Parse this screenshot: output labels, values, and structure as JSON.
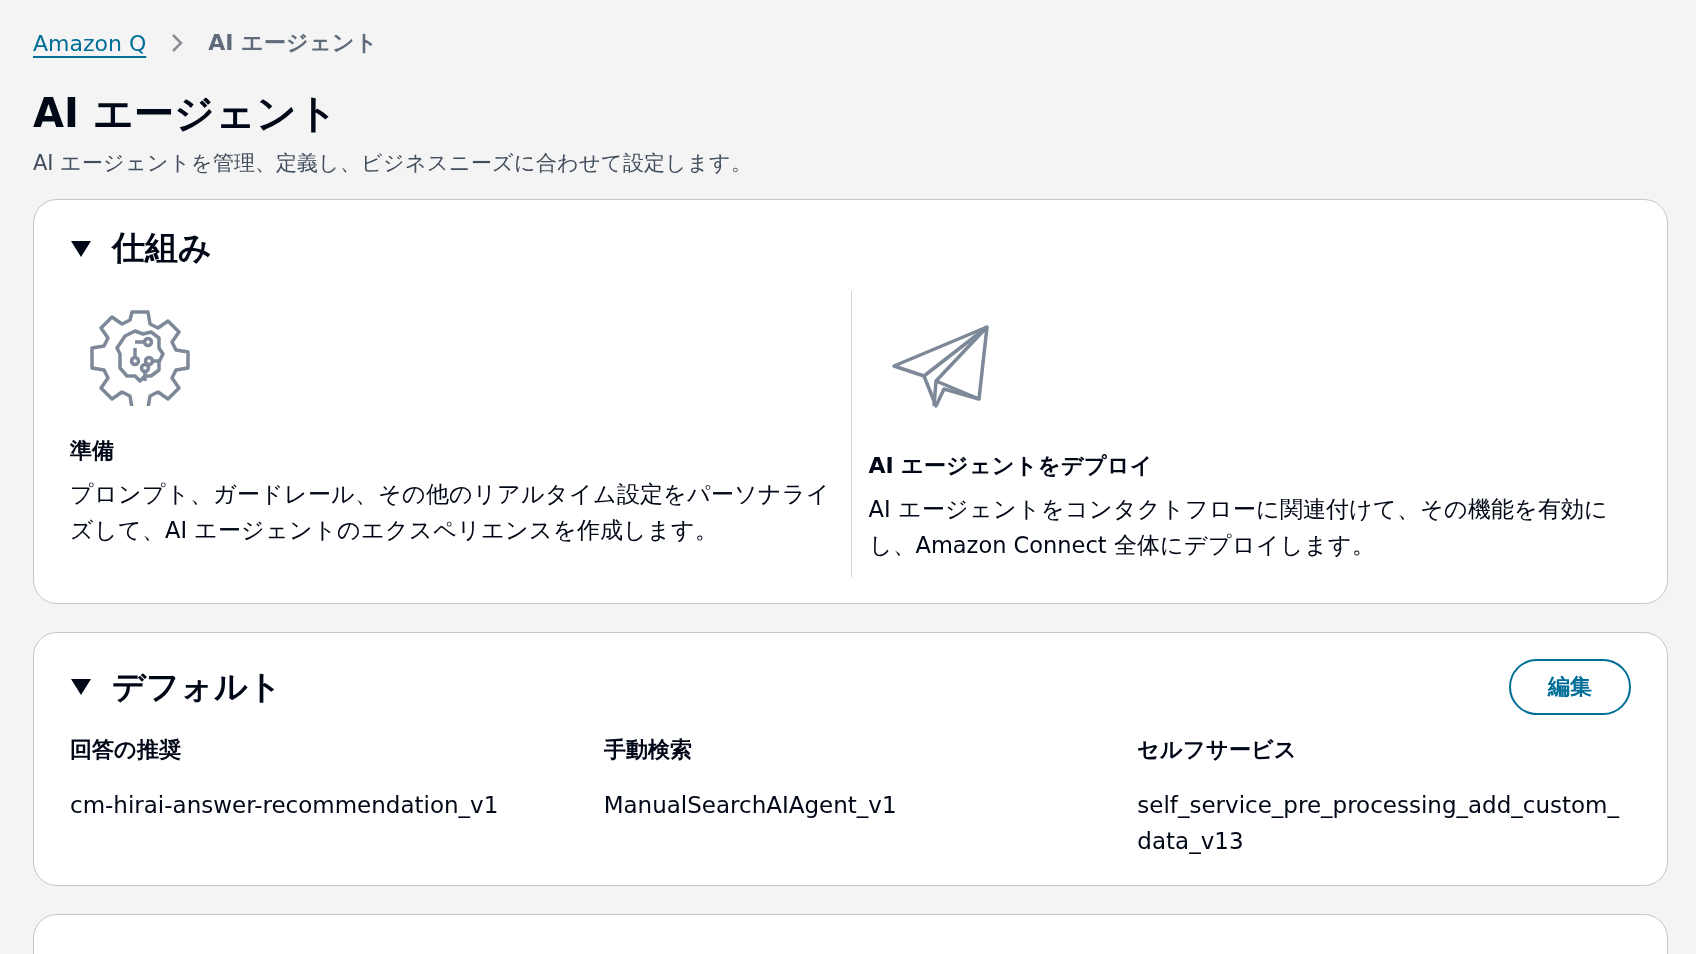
{
  "breadcrumb": [
    {
      "label": "Amazon Q",
      "kind": "link"
    },
    {
      "label": "AI エージェント",
      "kind": "current"
    }
  ],
  "page": {
    "title": "AI エージェント",
    "description": "AI エージェントを管理、定義し、ビジネスニーズに合わせて設定します。"
  },
  "how_it_works": {
    "title": "仕組み",
    "expanded": true,
    "steps": [
      {
        "kind": "gear",
        "title": "準備",
        "text": "プロンプト、ガードレール、その他のリアルタイム設定をパーソナライズして、AI エージェントのエクスペリエンスを作成します。"
      },
      {
        "kind": "plane",
        "title": "AI エージェントをデプロイ",
        "text": "AI エージェントをコンタクトフローに関連付けて、その機能を有効にし、Amazon Connect 全体にデプロイします。"
      }
    ]
  },
  "defaults": {
    "title": "デフォルト",
    "expanded": true,
    "edit_button": "編集",
    "fields": [
      {
        "label": "回答の推奨",
        "value": "cm-hirai-answer-recommendation_v1"
      },
      {
        "label": "手動検索",
        "value": "ManualSearchAIAgent_v1"
      },
      {
        "label": "セルフサービス",
        "value": "self_service_pre_processing_add_custom_data_v13"
      }
    ]
  }
}
